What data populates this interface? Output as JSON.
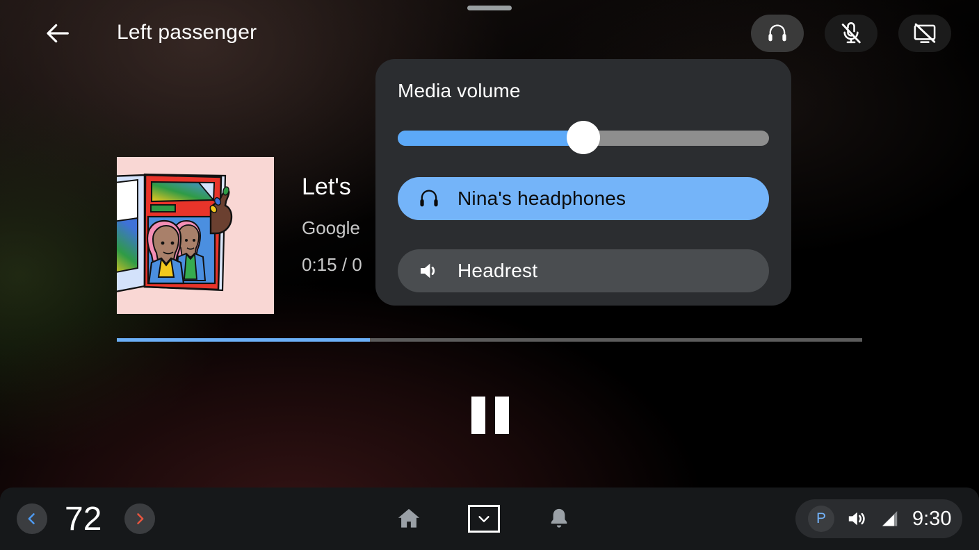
{
  "window": {
    "title": "Left passenger",
    "drag_handle": "drag-handle"
  },
  "topbar": {
    "back_icon": "arrow-left-icon",
    "title": "Left passenger",
    "actions": [
      {
        "name": "headphones",
        "icon": "headphones-icon",
        "active": true
      },
      {
        "name": "microphone-off",
        "icon": "mic-off-icon",
        "active": false
      },
      {
        "name": "screen-off",
        "icon": "screen-off-icon",
        "active": false
      }
    ]
  },
  "media": {
    "album_art_alt": "album-art-illustration",
    "title": "Let's",
    "artist": "Google",
    "time": "0:15 / 0",
    "progress_percent": 34,
    "transport": {
      "state": "playing",
      "button_icon": "pause-icon"
    }
  },
  "volume_panel": {
    "title": "Media volume",
    "slider": {
      "value_percent": 50,
      "fill_color": "#5ca9f8",
      "track_color": "#8e8e8e"
    },
    "devices": [
      {
        "label": "Nina's headphones",
        "icon": "headphones-icon",
        "selected": true,
        "color": "#74b4f9"
      },
      {
        "label": "Headrest",
        "icon": "speaker-icon",
        "selected": false,
        "color": "#4a4d50"
      }
    ]
  },
  "bottom_bar": {
    "temperature": {
      "value": "72",
      "decrease_icon": "chevron-left-icon",
      "decrease_color": "#4e9af1",
      "increase_icon": "chevron-right-icon",
      "increase_color": "#e8553f"
    },
    "nav": [
      {
        "name": "home",
        "icon": "home-icon"
      },
      {
        "name": "apps",
        "icon": "chevron-down-icon"
      },
      {
        "name": "notifications",
        "icon": "bell-icon"
      }
    ],
    "status": {
      "gear_label": "P",
      "gear_color": "#73b2f8",
      "volume_icon": "volume-icon",
      "signal_icon": "signal-icon",
      "clock": "9:30"
    }
  },
  "colors": {
    "accent_blue": "#6cb0f8",
    "panel_bg": "#2b2d30",
    "bottom_bar_bg": "#16181a"
  }
}
